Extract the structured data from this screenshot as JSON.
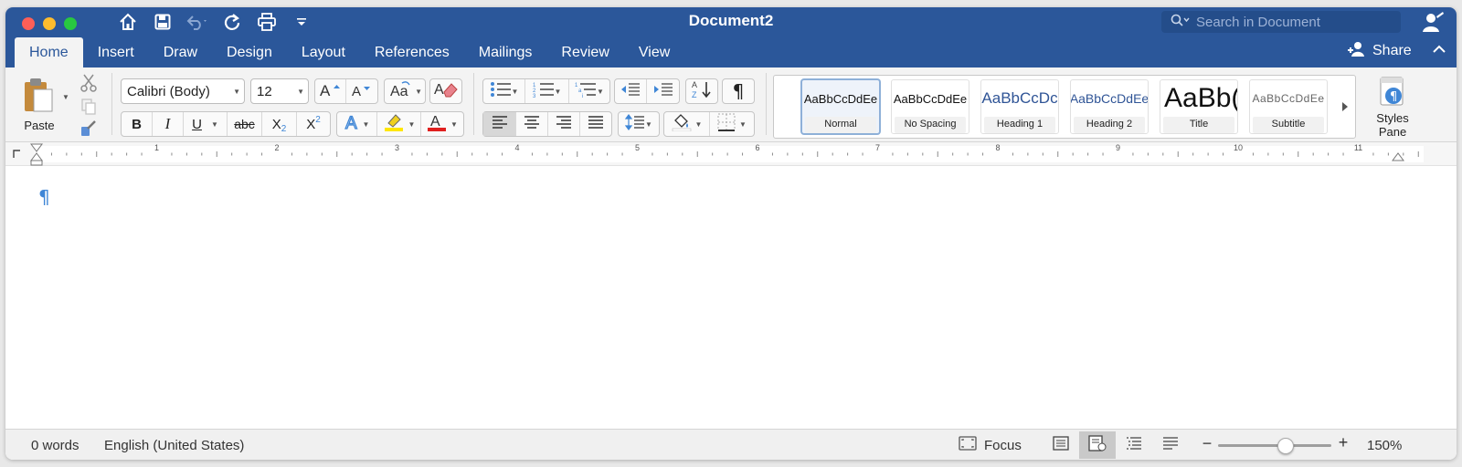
{
  "window": {
    "title": "Document2",
    "traffic_lights": {
      "close": "#fe5f57",
      "minimize": "#febc2e",
      "maximize": "#28c840"
    }
  },
  "colors": {
    "brand": "#2b579a",
    "accent_blue": "#3f86d6"
  },
  "quick_access": [
    {
      "name": "home-icon"
    },
    {
      "name": "save-icon"
    },
    {
      "name": "undo-icon"
    },
    {
      "name": "redo-icon"
    },
    {
      "name": "print-icon"
    },
    {
      "name": "customize-icon"
    }
  ],
  "search": {
    "placeholder": "Search in Document"
  },
  "tabs": [
    {
      "label": "Home",
      "active": true
    },
    {
      "label": "Insert"
    },
    {
      "label": "Draw"
    },
    {
      "label": "Design"
    },
    {
      "label": "Layout"
    },
    {
      "label": "References"
    },
    {
      "label": "Mailings"
    },
    {
      "label": "Review"
    },
    {
      "label": "View"
    }
  ],
  "share": {
    "label": "Share"
  },
  "clipboard": {
    "paste_label": "Paste"
  },
  "font": {
    "name": "Calibri (Body)",
    "size": "12"
  },
  "format_buttons": {
    "bold": "B",
    "italic": "I",
    "underline": "U",
    "strike": "abc",
    "sub": "X",
    "sub_mark": "2",
    "sup": "X",
    "sup_mark": "2"
  },
  "styles": [
    {
      "preview": "AaBbCcDdEe",
      "name": "Normal",
      "selected": true
    },
    {
      "preview": "AaBbCcDdEe",
      "name": "No Spacing"
    },
    {
      "preview": "AaBbCcDc",
      "name": "Heading 1"
    },
    {
      "preview": "AaBbCcDdEe",
      "name": "Heading 2"
    },
    {
      "preview": "AaBb(",
      "name": "Title"
    },
    {
      "preview": "AaBbCcDdEe",
      "name": "Subtitle"
    }
  ],
  "styles_pane": {
    "line1": "Styles",
    "line2": "Pane"
  },
  "ruler": {
    "numbers": [
      "1",
      "2",
      "3",
      "4",
      "5",
      "6",
      "7",
      "8",
      "9",
      "10",
      "11"
    ]
  },
  "document": {
    "pilcrow": "¶"
  },
  "status": {
    "word_count": "0 words",
    "language": "English (United States)",
    "focus_label": "Focus",
    "zoom": "150%",
    "zoom_level": 0.6
  }
}
